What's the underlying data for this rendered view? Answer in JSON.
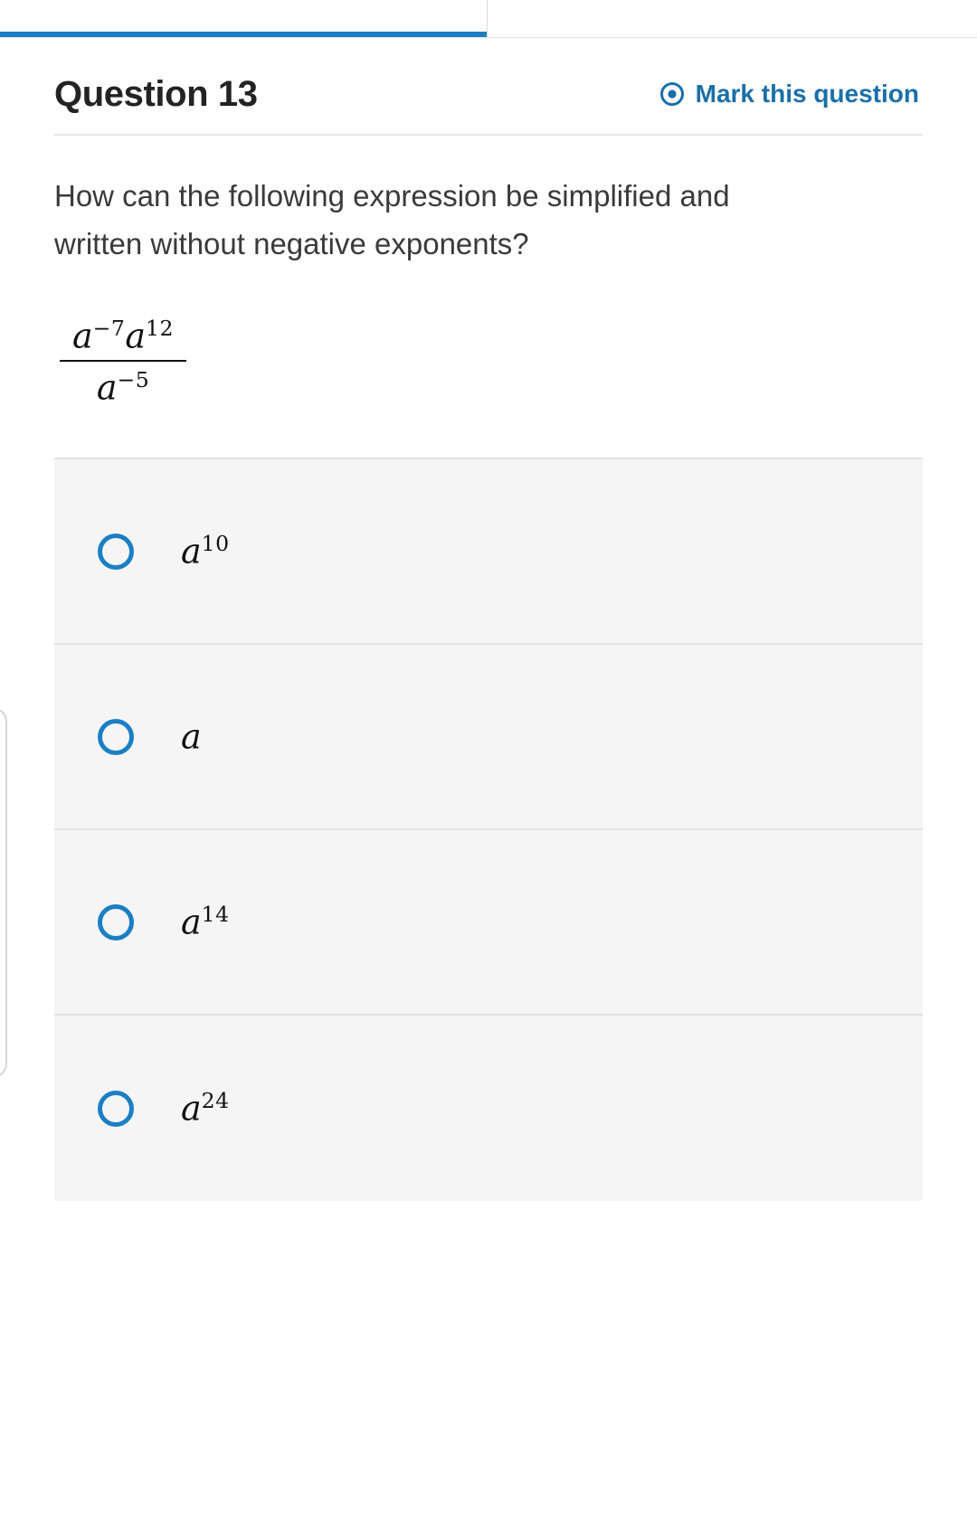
{
  "tabs": {
    "active_tab": "",
    "inactive_tab": "",
    "accent_color": "#1b7fc4"
  },
  "header": {
    "title": "Question 13",
    "mark_question_label": "Mark this question",
    "mark_question_icon": "radio-target-icon",
    "link_color": "#1b6fa8"
  },
  "prompt": {
    "text": "How can the following expression be simplified and written without negative exponents?"
  },
  "expression": {
    "numerator_base_1": "a",
    "numerator_exp_1": "−7",
    "numerator_base_2": "a",
    "numerator_exp_2": "12",
    "denominator_base": "a",
    "denominator_exp": "−5"
  },
  "options": [
    {
      "base": "a",
      "exponent": "10",
      "selected": false,
      "icon": "radio-unchecked-icon"
    },
    {
      "base": "a",
      "exponent": "",
      "selected": false,
      "icon": "radio-unchecked-icon"
    },
    {
      "base": "a",
      "exponent": "14",
      "selected": false,
      "icon": "radio-unchecked-icon"
    },
    {
      "base": "a",
      "exponent": "24",
      "selected": false,
      "icon": "radio-unchecked-icon"
    }
  ]
}
